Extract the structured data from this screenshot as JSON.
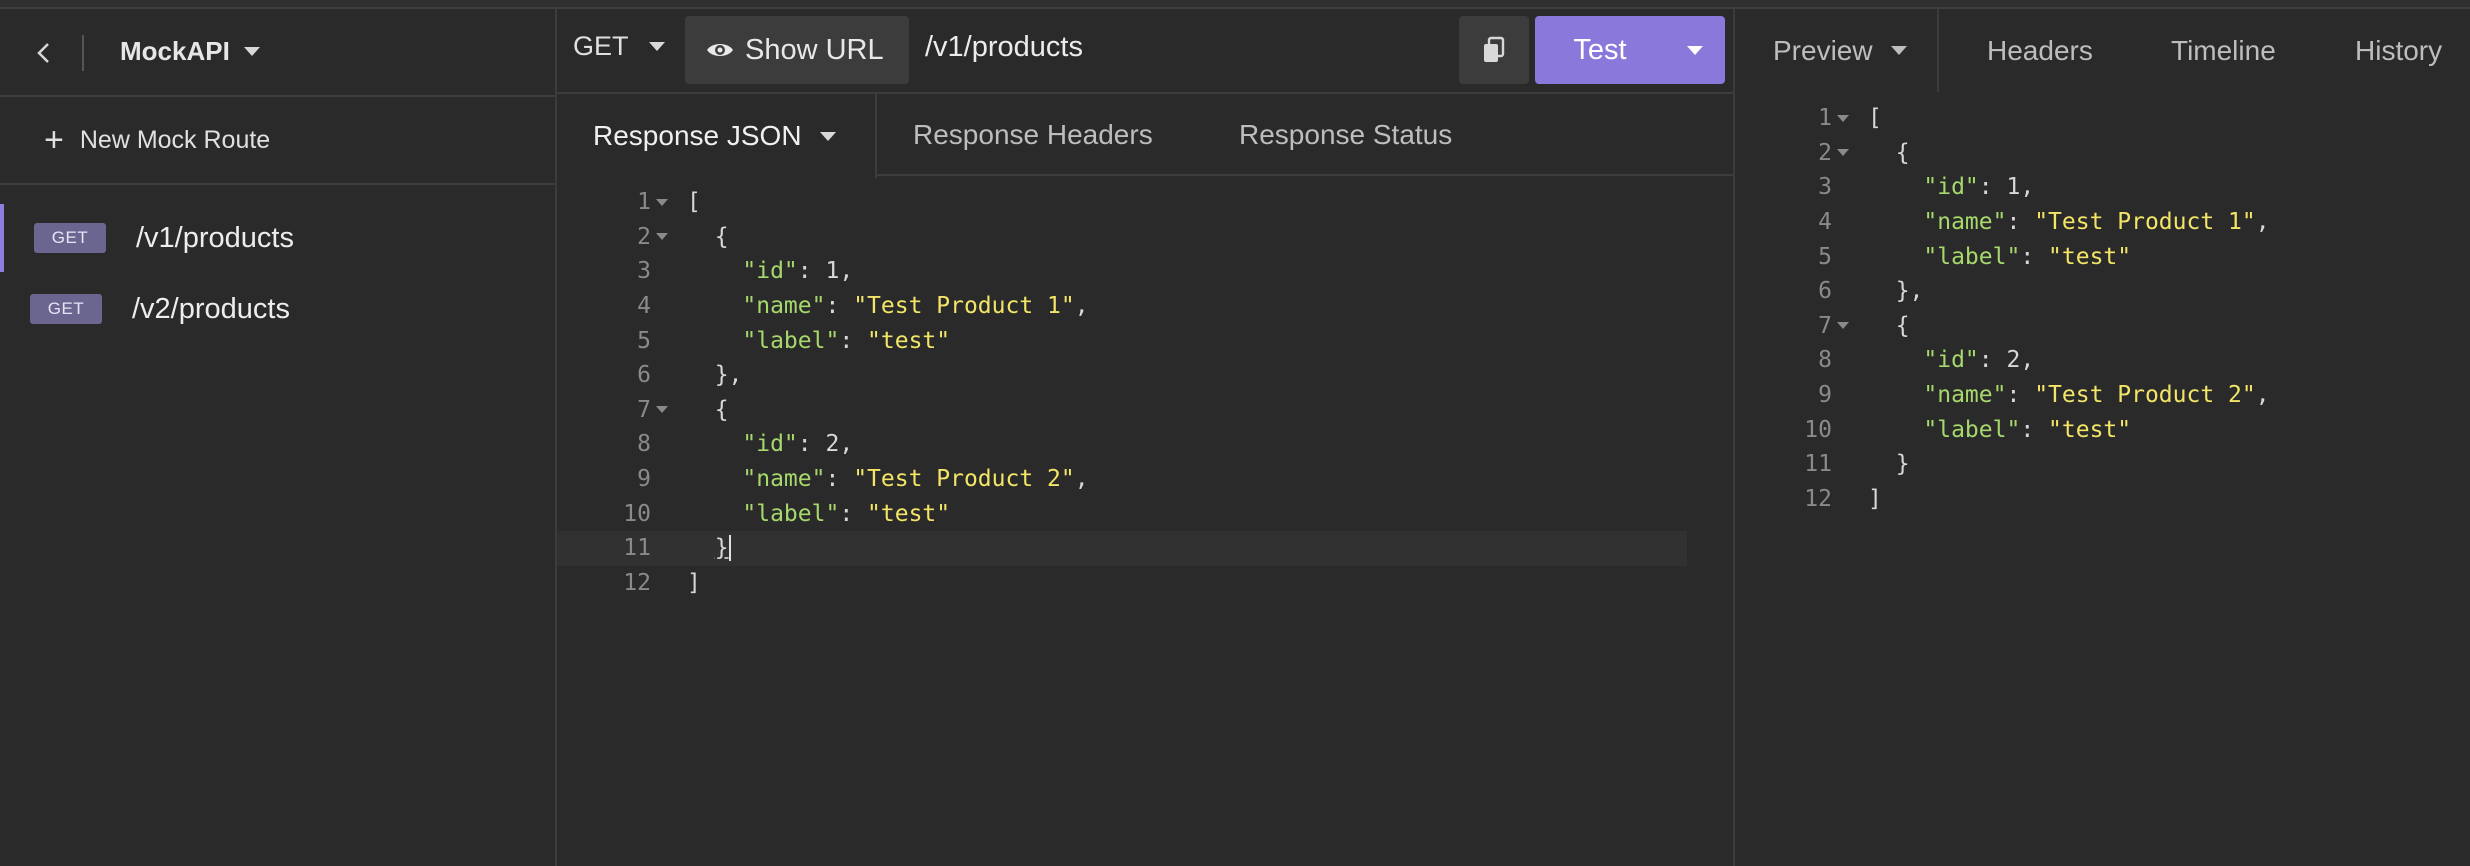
{
  "sidebar": {
    "workspace": "MockAPI",
    "new_route_label": "New Mock Route",
    "routes": [
      {
        "method": "GET",
        "path": "/v1/products",
        "active": true
      },
      {
        "method": "GET",
        "path": "/v2/products",
        "active": false
      }
    ]
  },
  "request": {
    "method": "GET",
    "show_url_label": "Show URL",
    "url": "/v1/products",
    "send_label": "Test"
  },
  "response_tabs": {
    "json": "Response JSON",
    "headers": "Response Headers",
    "status": "Response Status"
  },
  "editor": {
    "lines": [
      {
        "n": "1",
        "fold": true
      },
      {
        "n": "2",
        "fold": true
      },
      {
        "n": "3",
        "fold": false
      },
      {
        "n": "4",
        "fold": false
      },
      {
        "n": "5",
        "fold": false
      },
      {
        "n": "6",
        "fold": false
      },
      {
        "n": "7",
        "fold": true
      },
      {
        "n": "8",
        "fold": false
      },
      {
        "n": "9",
        "fold": false
      },
      {
        "n": "10",
        "fold": false
      },
      {
        "n": "11",
        "fold": false
      },
      {
        "n": "12",
        "fold": false
      }
    ],
    "tokens": {
      "open_bracket": "[",
      "open_brace": "{",
      "close_brace_comma": "},",
      "close_brace": "}",
      "close_bracket": "]",
      "key_id": "\"id\"",
      "key_name": "\"name\"",
      "key_label": "\"label\"",
      "val_id_1": "1",
      "val_id_2": "2",
      "val_name_1": "\"Test Product 1\"",
      "val_name_2": "\"Test Product 2\"",
      "val_label": "\"test\""
    },
    "current_line": "11"
  },
  "preview_panel": {
    "tabs": [
      "Preview",
      "Headers",
      "Timeline",
      "History"
    ]
  },
  "colors": {
    "accent": "#8a79da",
    "json_key": "#a6d86c",
    "json_string": "#f2e567",
    "badge": "#6b6690"
  }
}
